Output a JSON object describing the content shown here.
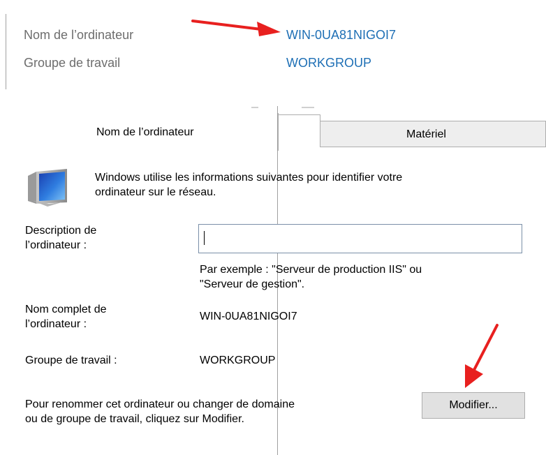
{
  "summary": {
    "computer_name_label": "Nom de l’ordinateur",
    "computer_name_value": "WIN-0UA81NIGOI7",
    "workgroup_label": "Groupe de travail",
    "workgroup_value": "WORKGROUP"
  },
  "dialog": {
    "tabs": [
      {
        "label": "Nom de l’ordinateur",
        "active": true
      },
      {
        "label": "Matériel",
        "active": false
      }
    ],
    "intro": [
      "Windows utilise les informations suivantes pour identifier votre",
      "ordinateur sur le réseau."
    ],
    "description_label": [
      "Description de",
      "l’ordinateur :"
    ],
    "description_value": "",
    "example_text": [
      "Par exemple : \"Serveur de production IIS\" ou",
      "\"Serveur de gestion\"."
    ],
    "full_name_label": [
      "Nom complet de",
      "l’ordinateur :"
    ],
    "full_name_value": "WIN-0UA81NIGOI7",
    "workgroup_label": "Groupe de travail :",
    "workgroup_value": "WORKGROUP",
    "rename_text": [
      "Pour renommer cet ordinateur ou changer de domaine",
      "ou de groupe de travail, cliquez sur Modifier."
    ],
    "modify_button_label": "Modifier..."
  },
  "colors": {
    "link_blue": "#1e6fb5",
    "annotation_red": "#e8201f",
    "label_gray": "#6d6d6d"
  },
  "icons": [
    "computer-monitor-icon",
    "red-annotation-arrow"
  ]
}
